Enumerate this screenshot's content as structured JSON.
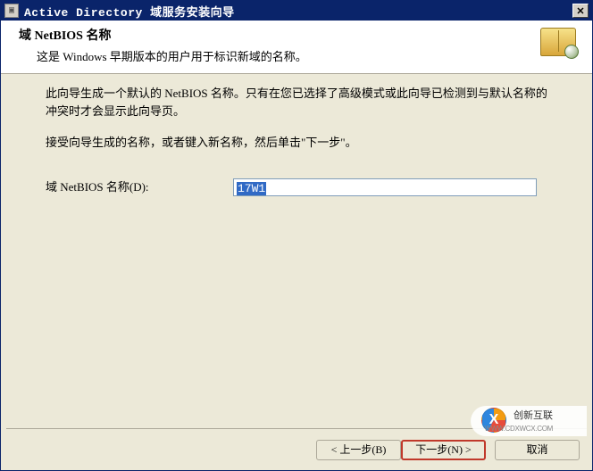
{
  "window": {
    "title": "Active Directory 域服务安装向导"
  },
  "header": {
    "title": "域 NetBIOS 名称",
    "subtitle": "这是 Windows 早期版本的用户用于标识新域的名称。"
  },
  "body": {
    "para1": "此向导生成一个默认的 NetBIOS 名称。只有在您已选择了高级模式或此向导已检测到与默认名称的冲突时才会显示此向导页。",
    "para2": "接受向导生成的名称，或者键入新名称，然后单击\"下一步\"。",
    "field_label": "域 NetBIOS 名称(D):",
    "field_value": "17W1"
  },
  "footer": {
    "back": "< 上一步(B)",
    "next": "下一步(N) >",
    "cancel": "取消"
  },
  "watermark": {
    "name": "创新互联",
    "sub": "WWW.CDXWCX.COM"
  }
}
